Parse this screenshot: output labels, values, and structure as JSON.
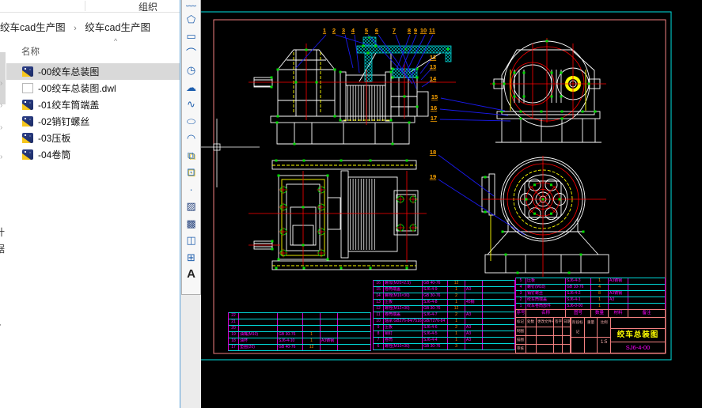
{
  "explorer": {
    "organize_label": "组织",
    "breadcrumb": {
      "crumb1": "绞车cad生产图",
      "separator": "›",
      "crumb2": "绞车cad生产图"
    },
    "column_header": "名称",
    "sort_caret": "^",
    "files": [
      {
        "label": "-00绞车总装图"
      },
      {
        "label": "-00绞车总装图.dwl"
      },
      {
        "label": "-01绞车筒端盖"
      },
      {
        "label": "-02销钉螺丝"
      },
      {
        "label": "-03压板"
      },
      {
        "label": "-04卷筒"
      }
    ],
    "tree_fragments": {
      "f1": "计",
      "f2": "据",
      "f3": "T"
    }
  },
  "draw_toolbar": {
    "tools": [
      {
        "name": "polyline",
        "glyph": "﹏"
      },
      {
        "name": "polygon",
        "glyph": "⬠"
      },
      {
        "name": "rectangle",
        "glyph": "▭"
      },
      {
        "name": "arc",
        "glyph": "⌒"
      },
      {
        "name": "circle",
        "glyph": "◷"
      },
      {
        "name": "revision-cloud",
        "glyph": "☁"
      },
      {
        "name": "spline",
        "glyph": "∿"
      },
      {
        "name": "ellipse",
        "glyph": "⬭"
      },
      {
        "name": "ellipse-arc",
        "glyph": "◠"
      },
      {
        "name": "insert-block",
        "glyph": "⧉"
      },
      {
        "name": "make-block",
        "glyph": "⊡"
      },
      {
        "name": "point",
        "glyph": "·"
      },
      {
        "name": "hatch",
        "glyph": "▨"
      },
      {
        "name": "gradient",
        "glyph": "▩"
      },
      {
        "name": "region",
        "glyph": "◫"
      },
      {
        "name": "table",
        "glyph": "⊞"
      },
      {
        "name": "multiline-text",
        "glyph": "A"
      }
    ]
  },
  "cad": {
    "colors": {
      "frame_outer": "#00e5e5",
      "frame_inner": "#f28080",
      "outline": "#ffffff",
      "centerline": "#ff0000",
      "hatch": "#00e5e5",
      "grip": "#00dd00",
      "leader": "#1a1aee",
      "balloon": "#ffa500",
      "bom_text": "#ff00ff",
      "qty_text": "#ff8c00",
      "title_text": "#ffff00"
    },
    "balloons_top": [
      "1",
      "2",
      "3",
      "4",
      "5",
      "6",
      "7",
      "8",
      "9",
      "10",
      "11"
    ],
    "balloons_right": [
      "12",
      "13",
      "14",
      "15",
      "16",
      "17",
      "18",
      "19"
    ],
    "bom_header": {
      "no": "序号",
      "name": "名称",
      "dwg": "图号",
      "qty": "数量",
      "mat": "材料",
      "rem": "备注"
    },
    "bom_left": [
      {
        "no": "22",
        "name": "",
        "dwg": "",
        "qty": "",
        "mat": "",
        "rem": ""
      },
      {
        "no": "21",
        "name": "",
        "dwg": "",
        "qty": "",
        "mat": "",
        "rem": ""
      },
      {
        "no": "20",
        "name": "",
        "dwg": "",
        "qty": "",
        "mat": "",
        "rem": ""
      },
      {
        "no": "19",
        "name": "油嘴(M10)",
        "dwg": "GB 30-76",
        "qty": "1",
        "mat": "",
        "rem": ""
      },
      {
        "no": "18",
        "name": "油杯",
        "dwg": "SJ6-4-10",
        "qty": "1",
        "mat": "A3铸钢",
        "rem": ""
      },
      {
        "no": "17",
        "name": "垫圈(20)",
        "dwg": "GB 40-76",
        "qty": "12",
        "mat": "",
        "rem": ""
      }
    ],
    "bom_right": [
      {
        "no": "16",
        "name": "螺母(M20×2.5)",
        "dwg": "GB 40-76",
        "qty": "12",
        "mat": "",
        "rem": ""
      },
      {
        "no": "15",
        "name": "卷筒端盖",
        "dwg": "SJ6-4-9",
        "qty": "1",
        "mat": "A3",
        "rem": ""
      },
      {
        "no": "14",
        "name": "螺栓(M16×30)",
        "dwg": "GB 30-76",
        "qty": "2",
        "mat": "",
        "rem": ""
      },
      {
        "no": "13",
        "name": "压板",
        "dwg": "SJ6-4-8",
        "qty": "1",
        "mat": "45钢",
        "rem": ""
      },
      {
        "no": "12",
        "name": "螺栓(M12×30)",
        "dwg": "GB 30-76",
        "qty": "12",
        "mat": "",
        "rem": ""
      },
      {
        "no": "11",
        "name": "卷筒端盖",
        "dwg": "SJ6-4-7",
        "qty": "2",
        "mat": "A3",
        "rem": ""
      },
      {
        "no": "10",
        "name": "轴承 GB276-84/7516",
        "dwg": "GB/T276-84",
        "qty": "1",
        "mat": "",
        "rem": ""
      },
      {
        "no": "9",
        "name": "压板",
        "dwg": "SJ6-4-6",
        "qty": "2",
        "mat": "A3",
        "rem": ""
      },
      {
        "no": "8",
        "name": "销钉",
        "dwg": "SJ6-4-5",
        "qty": "1",
        "mat": "A3",
        "rem": ""
      },
      {
        "no": "7",
        "name": "卷筒",
        "dwg": "SJ6-4-4",
        "qty": "1",
        "mat": "A3",
        "rem": ""
      },
      {
        "no": "6",
        "name": "螺栓(M10×30)",
        "dwg": "GB 30-76",
        "qty": "3",
        "mat": "",
        "rem": ""
      }
    ],
    "bom_main": [
      {
        "no": "5",
        "name": "压板",
        "dwg": "SJ6-4-3",
        "qty": "1",
        "mat": "A3铸钢",
        "rem": ""
      },
      {
        "no": "4",
        "name": "螺钉(M10)",
        "dwg": "GB 10-76",
        "qty": "4",
        "mat": "",
        "rem": ""
      },
      {
        "no": "3",
        "name": "销钉螺丝",
        "dwg": "SJ6-4-2",
        "qty": "8",
        "mat": "A3铸钢",
        "rem": ""
      },
      {
        "no": "2",
        "name": "绞车筒端盖",
        "dwg": "SJ6-4-1",
        "qty": "1",
        "mat": "A3",
        "rem": ""
      },
      {
        "no": "1",
        "name": "绞车卷筒部件",
        "dwg": "SJ6-0-00",
        "qty": "1",
        "mat": "",
        "rem": ""
      }
    ],
    "title_block": {
      "title": "绞车总装图",
      "drawing_no": "SJ6-4-00",
      "stage_label": "阶段标记",
      "weight_label": "重量",
      "scale_label": "比例",
      "scale_value": "1:5",
      "sig_rows": [
        {
          "a": "标记",
          "b": "处数",
          "c": "更改文件号",
          "d": "签字",
          "e": "日期"
        },
        {
          "a": "制图",
          "b": "",
          "c": "",
          "d": "",
          "e": ""
        },
        {
          "a": "描图",
          "b": "",
          "c": "",
          "d": "",
          "e": ""
        },
        {
          "a": "审核",
          "b": "",
          "c": "",
          "d": "",
          "e": ""
        }
      ]
    }
  }
}
